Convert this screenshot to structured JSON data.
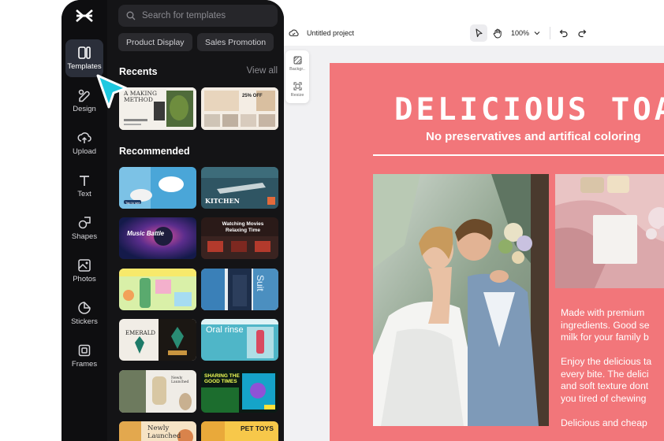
{
  "sidebar": {
    "items": [
      {
        "label": "Templates",
        "icon": "templates-icon",
        "active": true
      },
      {
        "label": "Design",
        "icon": "design-icon"
      },
      {
        "label": "Upload",
        "icon": "upload-icon"
      },
      {
        "label": "Text",
        "icon": "text-icon"
      },
      {
        "label": "Shapes",
        "icon": "shapes-icon"
      },
      {
        "label": "Photos",
        "icon": "photos-icon"
      },
      {
        "label": "Stickers",
        "icon": "stickers-icon"
      },
      {
        "label": "Frames",
        "icon": "frames-icon"
      }
    ]
  },
  "templates_panel": {
    "search_placeholder": "Search for templates",
    "chips": [
      "Product Display",
      "Sales Promotion"
    ],
    "recents_title": "Recents",
    "view_all": "View all",
    "recommended_title": "Recommended",
    "recent_thumbs": [
      {
        "text": "A MAKING METHOD"
      },
      {
        "text": "25% OFF"
      }
    ],
    "recommended_thumbs": [
      {
        "text": "Tap to see"
      },
      {
        "text": "KITCHEN"
      },
      {
        "text": "Music Battle"
      },
      {
        "text": "Watching Movies Relaxing Time"
      },
      {
        "text": ""
      },
      {
        "text": "Suit"
      },
      {
        "text": "EMERALD"
      },
      {
        "text": "Oral rinse"
      },
      {
        "text": "Newly Launched"
      },
      {
        "text": "SHARING THE GOOD TIMES"
      },
      {
        "text": "Newly Launched"
      },
      {
        "text": "PET TOYS"
      }
    ]
  },
  "topbar": {
    "project_title": "Untitled project",
    "zoom": "100%"
  },
  "canvas_tools": [
    {
      "label": "Backgr..",
      "icon": "background-icon"
    },
    {
      "label": "Resize",
      "icon": "resize-icon"
    }
  ],
  "design": {
    "title": "DELICIOUS TOAST",
    "subtitle": "No preservatives and artifical coloring",
    "body_lines": [
      "Made with premium",
      "ingredients. Good se",
      "milk for your family b",
      "",
      "Enjoy the delicious ta",
      "every bite. The delici",
      "and soft texture dont",
      "you tired of chewing",
      "",
      "Delicious and cheap"
    ]
  },
  "colors": {
    "panel_bg": "#0e0e10",
    "design_bg": "#f2767a",
    "cursor": "#1ec8e0",
    "active_rail": "#2b2f3a"
  }
}
